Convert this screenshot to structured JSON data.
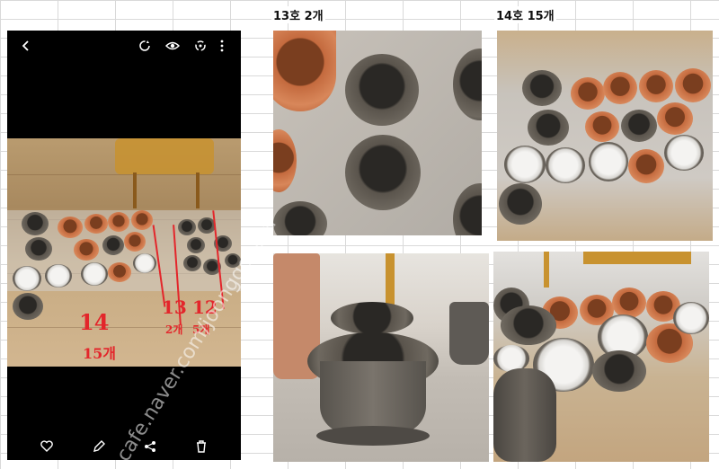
{
  "captions": {
    "left_photos": "13호 2개",
    "right_photos": "14호 15개"
  },
  "phone": {
    "icons": [
      "back-icon",
      "rotate-icon",
      "eye-icon",
      "sync-icon",
      "more-vertical-icon"
    ],
    "bottom_icons": [
      "heart-icon",
      "edit-icon",
      "share-icon",
      "trash-icon"
    ],
    "annotation_14": "14",
    "annotation_15": "15개",
    "annotation_13": "13",
    "annotation_12": "12",
    "annotation_2": "2개",
    "annotation_5": "5개"
  },
  "watermark": "cafe.naver.com/joonggonara",
  "colors": {
    "annotation": "#e3262b",
    "terracotta": "#c46a3e",
    "grey_pot": "#5a544c",
    "bubble_wrap": "#c9c7c4"
  }
}
